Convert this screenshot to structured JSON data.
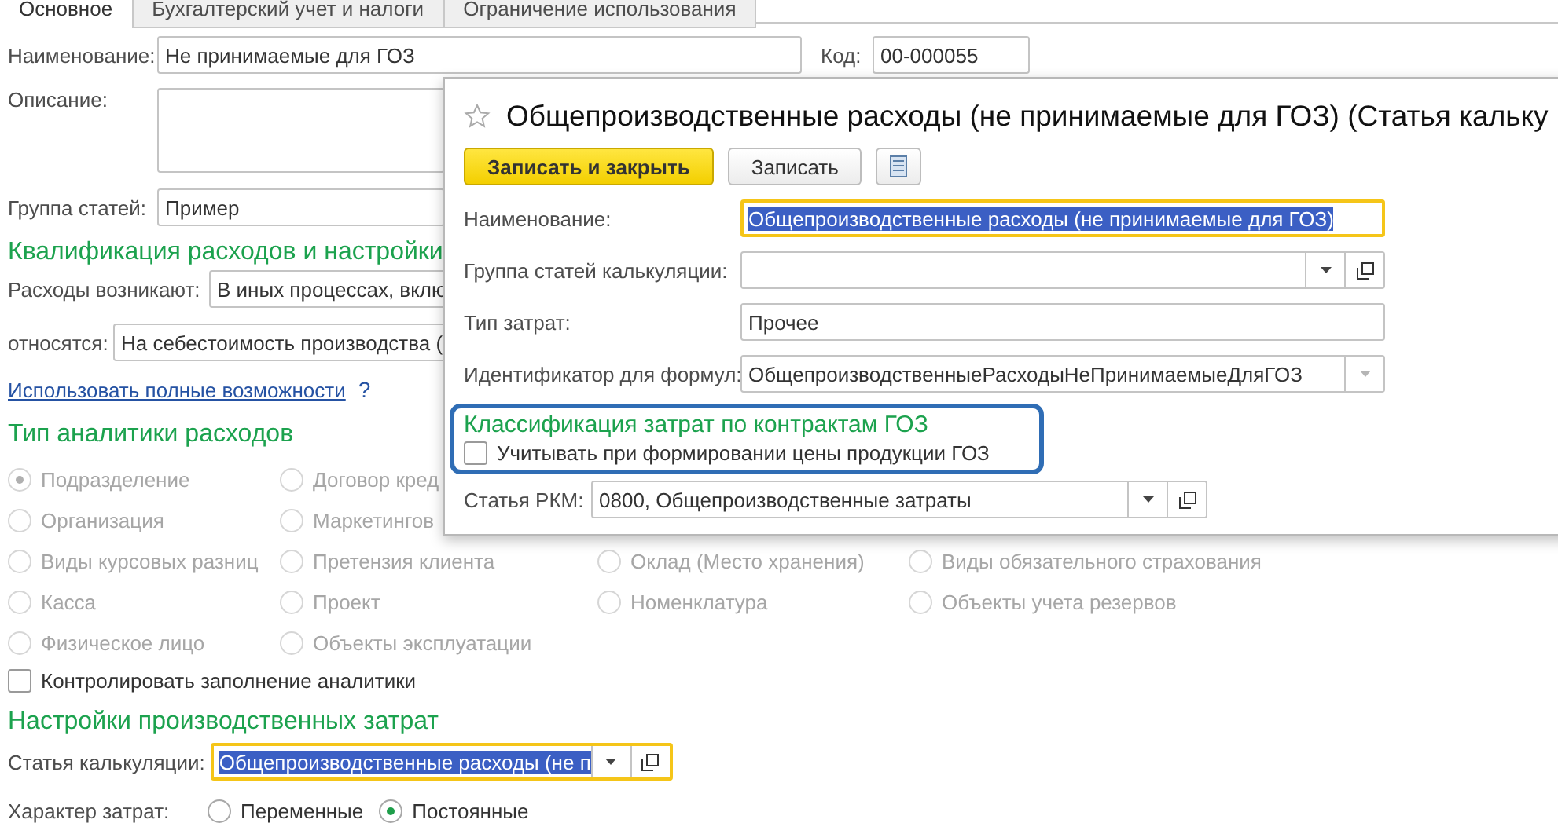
{
  "tabs": [
    {
      "label": "Основное",
      "selected": true
    },
    {
      "label": "Бухгалтерский учет и налоги",
      "selected": false
    },
    {
      "label": "Ограничение использования",
      "selected": false
    }
  ],
  "main_form": {
    "name": {
      "label": "Наименование:",
      "value": "Не принимаемые для ГОЗ"
    },
    "code": {
      "label": "Код:",
      "value": "00-000055"
    },
    "description": {
      "label": "Описание:"
    },
    "group": {
      "label": "Группа статей:",
      "value": "Пример"
    },
    "qualification_heading": "Квалификация расходов и настройки",
    "arise": {
      "label": "Расходы возникают:",
      "value": "В иных процессах, вклю"
    },
    "relate": {
      "label": "относятся:",
      "value": "На себестоимость производства ("
    },
    "full_features_link": "Использовать полные возможности",
    "help": "?",
    "analytics_heading": "Тип аналитики расходов",
    "analytics_columns": [
      {
        "items": [
          {
            "label": "Подразделение",
            "selected": true,
            "disabled": true
          },
          {
            "label": "Организация",
            "selected": false,
            "disabled": true
          },
          {
            "label": "Виды курсовых разниц",
            "selected": false,
            "disabled": true
          },
          {
            "label": "Касса",
            "selected": false,
            "disabled": true
          },
          {
            "label": "Физическое лицо",
            "selected": false,
            "disabled": true
          }
        ]
      },
      {
        "items": [
          {
            "label": "Договор кред",
            "selected": false,
            "disabled": true
          },
          {
            "label": "Маркетингов",
            "selected": false,
            "disabled": true
          },
          {
            "label": "Претензия клиента",
            "selected": false,
            "disabled": true
          },
          {
            "label": "Проект",
            "selected": false,
            "disabled": true
          },
          {
            "label": "Объекты эксплуатации",
            "selected": false,
            "disabled": true
          }
        ]
      },
      {
        "items": [
          {
            "label": "Оклад (Место хранения)",
            "selected": false,
            "disabled": true
          },
          {
            "label": "Номенклатура",
            "selected": false,
            "disabled": true
          }
        ]
      },
      {
        "items": [
          {
            "label": "Виды обязательного страхования",
            "selected": false,
            "disabled": true
          },
          {
            "label": "Объекты учета резервов",
            "selected": false,
            "disabled": true
          }
        ]
      }
    ],
    "control_analytics": {
      "label": "Контролировать заполнение аналитики",
      "checked": false
    },
    "production_heading": "Настройки производственных затрат",
    "calc_item": {
      "label": "Статья калькуляции:",
      "value": "Общепроизводственные расходы (не п",
      "focused": true,
      "text_selected": true
    },
    "cost_nature": {
      "label": "Характер затрат:",
      "options": [
        {
          "label": "Переменные",
          "selected": false
        },
        {
          "label": "Постоянные",
          "selected": true
        }
      ]
    }
  },
  "dialog": {
    "title": "Общепроизводственные расходы (не принимаемые для ГОЗ) (Статья кальку",
    "buttons": [
      {
        "kind": "primary",
        "label": "Записать и закрыть"
      },
      {
        "kind": "default",
        "label": "Записать"
      },
      {
        "kind": "icon"
      }
    ],
    "fields": [
      {
        "kind": "text",
        "label": "Наименование:",
        "value": "Общепроизводственные расходы (не принимаемые для ГОЗ)",
        "focused": true,
        "text_selected": true
      },
      {
        "kind": "combo",
        "label": "Группа статей калькуляции:"
      },
      {
        "kind": "text",
        "label": "Тип затрат:",
        "value": "Прочее",
        "focused": false,
        "text_selected": false
      },
      {
        "kind": "select",
        "label": "Идентификатор для формул:",
        "value": "ОбщепроизводственныеРасходыНеПринимаемыеДляГОЗ"
      }
    ],
    "goz_group": {
      "heading": "Классификация затрат по контрактам ГОЗ",
      "checkbox": {
        "label": "Учитывать при формировании цены продукции ГОЗ",
        "checked": false
      }
    },
    "rkm": {
      "label": "Статья РКМ:",
      "value": "0800, Общепроизводственные затраты"
    }
  }
}
